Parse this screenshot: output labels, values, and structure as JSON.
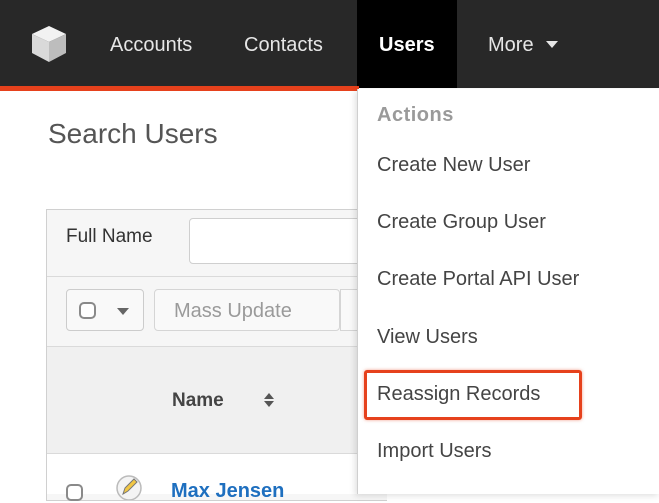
{
  "nav": {
    "items": [
      {
        "label": "Accounts"
      },
      {
        "label": "Contacts"
      },
      {
        "label": "Users"
      },
      {
        "label": "More"
      }
    ]
  },
  "page": {
    "title": "Search Users"
  },
  "filter": {
    "label": "Full Name",
    "value": ""
  },
  "toolbar": {
    "mass_update": "Mass Update"
  },
  "table": {
    "columns": [
      "Name"
    ],
    "rows": [
      {
        "name": "Max Jensen"
      }
    ]
  },
  "menu": {
    "header": "Actions",
    "items": [
      {
        "label": "Create New User"
      },
      {
        "label": "Create Group User"
      },
      {
        "label": "Create Portal API User"
      },
      {
        "label": "View Users"
      },
      {
        "label": "Reassign Records"
      },
      {
        "label": "Import Users"
      }
    ]
  },
  "colors": {
    "nav_bg": "#282828",
    "accent": "#e6411c",
    "link": "#1e6fbf"
  }
}
